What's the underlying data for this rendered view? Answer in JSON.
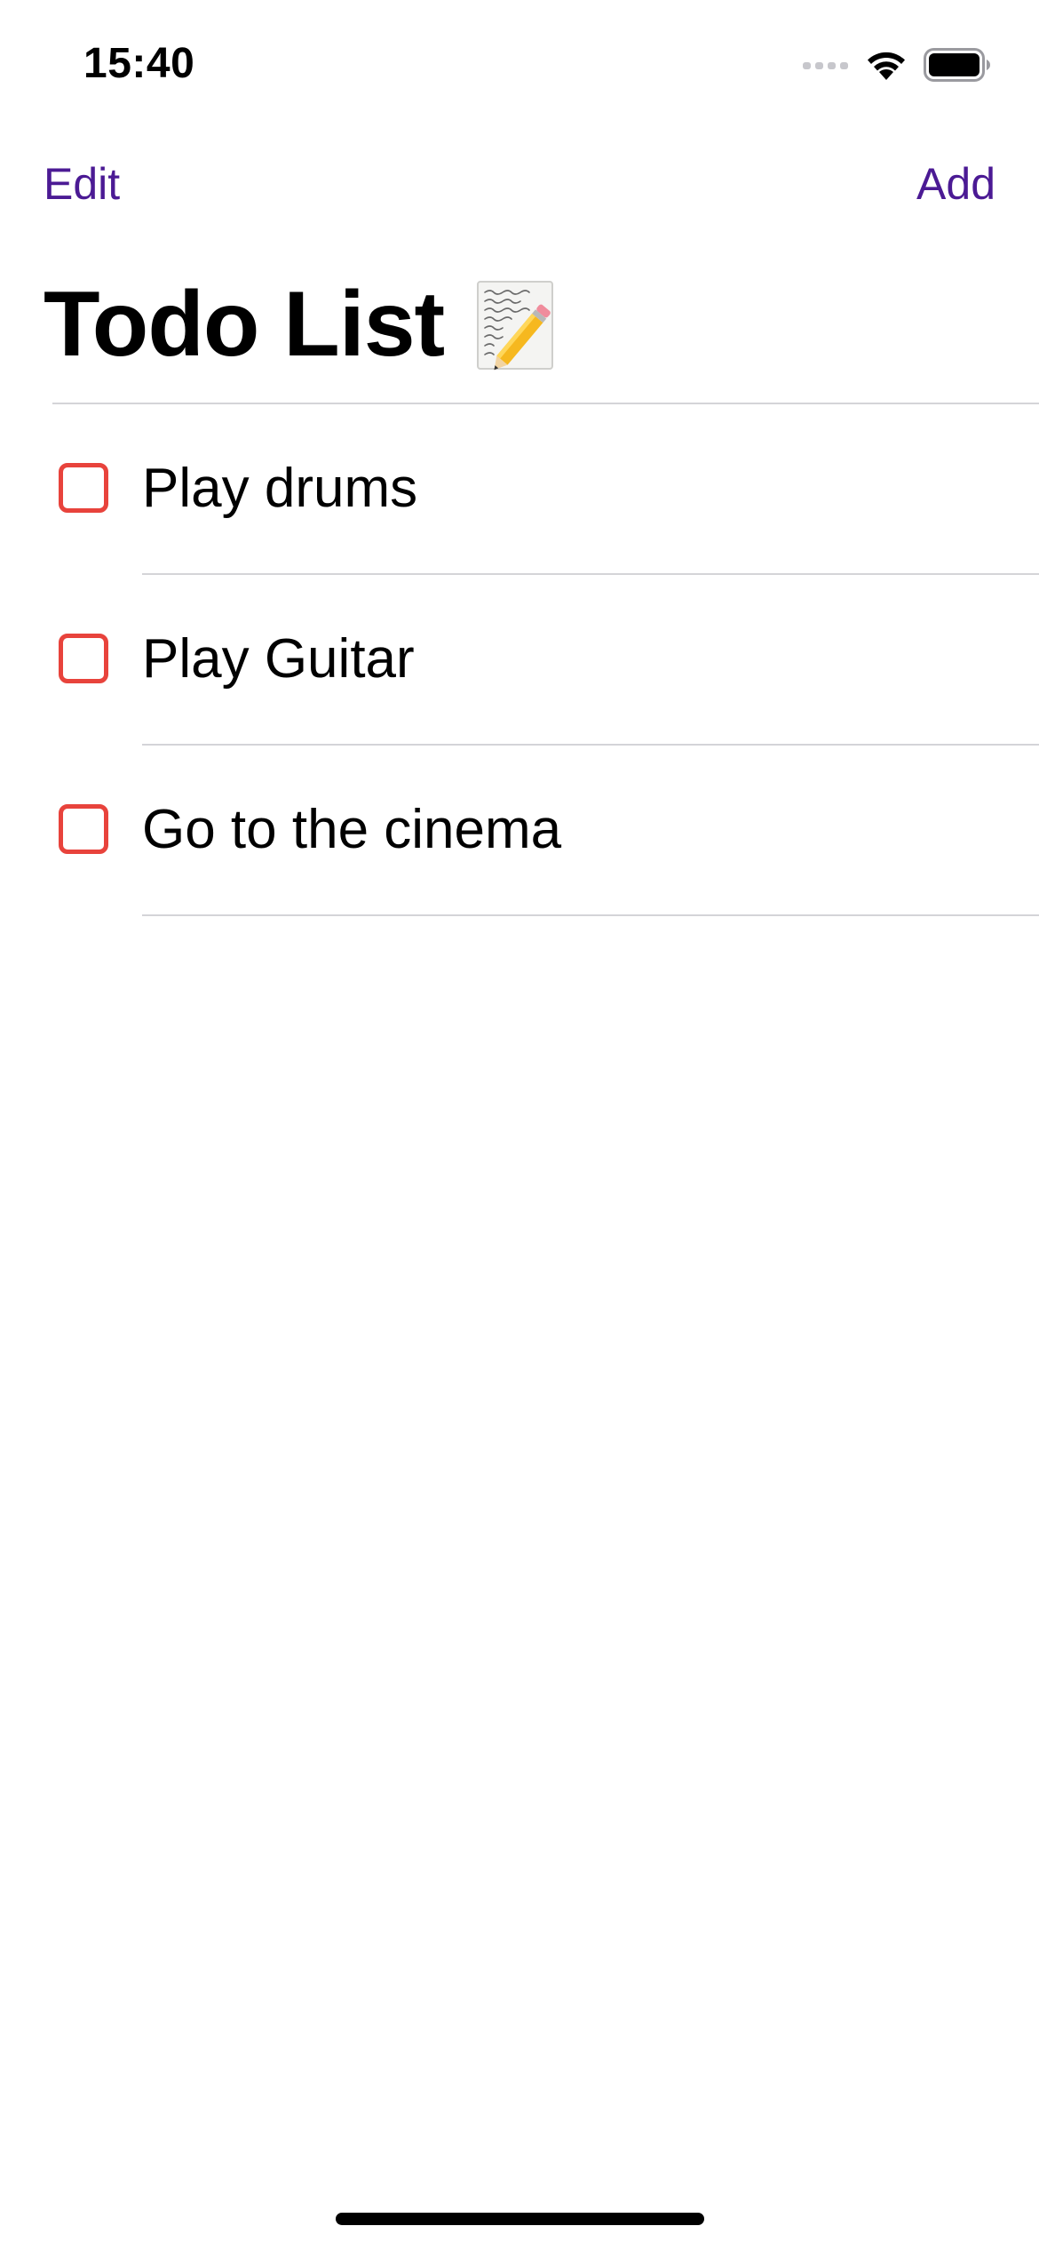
{
  "status_bar": {
    "time": "15:40",
    "icons": [
      "cellular-signal-icon",
      "wifi-icon",
      "battery-icon"
    ]
  },
  "nav": {
    "edit_label": "Edit",
    "add_label": "Add"
  },
  "title": {
    "text": "Todo List",
    "emoji_icon": "memo-pencil-icon"
  },
  "todos": [
    {
      "label": "Play drums",
      "completed": false
    },
    {
      "label": "Play Guitar",
      "completed": false
    },
    {
      "label": "Go to the cinema",
      "completed": false
    }
  ],
  "colors": {
    "accent": "#4B1A94",
    "checkbox": "#E8433C",
    "divider": "#D4D4D8"
  }
}
